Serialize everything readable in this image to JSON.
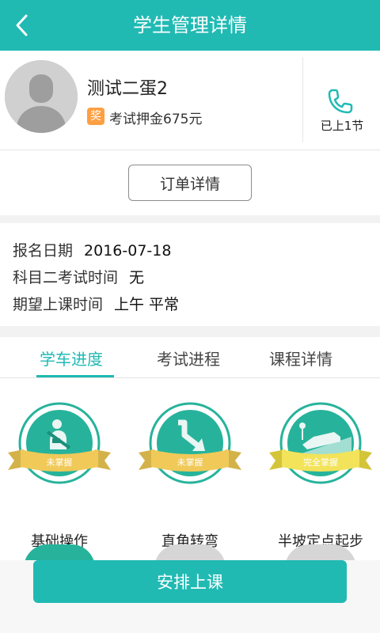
{
  "header": {
    "title": "学生管理详情",
    "back_icon": "chevron-left-icon",
    "bg_color": "#20bab3"
  },
  "student": {
    "name": "测试二蛋2",
    "badge": "奖",
    "deposit": "考试押金675元",
    "lessons": "已上1节",
    "phone_icon": "phone-icon"
  },
  "order": {
    "button_label": "订单详情"
  },
  "info": {
    "signup_label": "报名日期",
    "signup_value": "2016-07-18",
    "exam_label": "科目二考试时间",
    "exam_value": "无",
    "preferred_label": "期望上课时间",
    "preferred_value": "上午 平常"
  },
  "tabs": [
    {
      "label": "学车进度",
      "active": true
    },
    {
      "label": "考试进程",
      "active": false
    },
    {
      "label": "课程详情",
      "active": false
    }
  ],
  "skills": [
    {
      "label": "基础操作",
      "status": "未掌握",
      "icon": "seatbelt-icon",
      "mastered": false
    },
    {
      "label": "直角转弯",
      "status": "未掌握",
      "icon": "turn-arrow-icon",
      "mastered": false
    },
    {
      "label": "半坡定点起步",
      "status": "完全掌握",
      "icon": "car-on-slope-icon",
      "mastered": true
    }
  ],
  "footer": {
    "button_label": "安排上课"
  },
  "colors": {
    "accent": "#20bab3",
    "medal_green": "#27b39b",
    "medal_gold": "#f0c958",
    "medal_mastered_ribbon": "#f2e35a"
  }
}
